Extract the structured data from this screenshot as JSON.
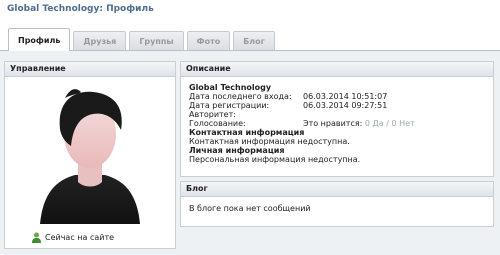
{
  "header": {
    "title": "Global Technology: Профиль"
  },
  "tabs": [
    {
      "label": "Профиль",
      "active": true
    },
    {
      "label": "Друзья"
    },
    {
      "label": "Группы"
    },
    {
      "label": "Фото"
    },
    {
      "label": "Блог"
    }
  ],
  "manage": {
    "title": "Управление",
    "status": "Сейчас на сайте"
  },
  "description": {
    "title": "Описание",
    "name": "Global Technology",
    "last_login_label": "Дата последнего входа:",
    "last_login_value": "06.03.2014 10:51:07",
    "reg_label": "Дата регистрации:",
    "reg_value": "06.03.2014 09:27:51",
    "authority_label": "Авторитет:",
    "vote_label": "Голосование:",
    "vote_likes": "Это нравится:",
    "vote_yes": "0 Да",
    "vote_sep": "/",
    "vote_no": "0 Нет",
    "contact_title": "Контактная информация",
    "contact_text": "Контактная информация недоступна.",
    "personal_title": "Личная информация",
    "personal_text": "Персональная информация недоступна."
  },
  "blog": {
    "title": "Блог",
    "empty": "В блоге пока нет сообщений"
  }
}
